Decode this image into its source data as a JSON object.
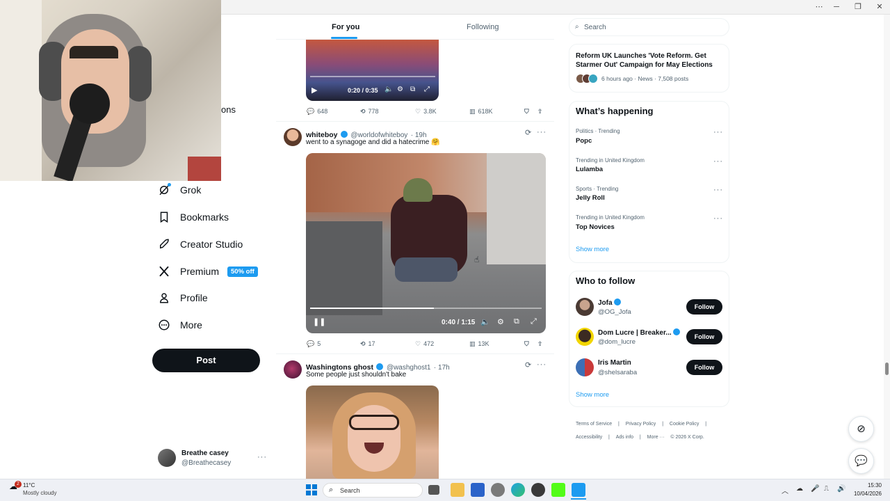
{
  "window": {
    "minimize": "─",
    "restore": "❐",
    "close": "✕",
    "extra": "⋯"
  },
  "webcam": {
    "partial_nav_text": "ons"
  },
  "sidebar": {
    "items": [
      {
        "label": "Grok",
        "icon": "grok-icon"
      },
      {
        "label": "Bookmarks",
        "icon": "bookmark-icon"
      },
      {
        "label": "Creator Studio",
        "icon": "rocket-icon"
      },
      {
        "label": "Premium",
        "icon": "x-logo-icon",
        "badge": "50% off"
      },
      {
        "label": "Profile",
        "icon": "person-icon"
      },
      {
        "label": "More",
        "icon": "more-circle-icon"
      }
    ],
    "post_label": "Post",
    "account": {
      "name": "Breathe casey",
      "handle": "@Breathecasey",
      "more": "···"
    }
  },
  "timeline": {
    "tabs": [
      "For you",
      "Following"
    ],
    "tweet0": {
      "video": {
        "time": "0:20 / 0:35"
      },
      "stats": {
        "replies": "648",
        "reposts": "778",
        "likes": "3.8K",
        "views": "618K"
      }
    },
    "tweet1": {
      "name": "whiteboy",
      "handle": "@worldofwhiteboy",
      "time": "· 19h",
      "text": "went to a synagoge and did a hatecrime 🤗",
      "video": {
        "time": "0:40 / 1:15"
      },
      "stats": {
        "replies": "5",
        "reposts": "17",
        "likes": "472",
        "views": "13K"
      }
    },
    "tweet2": {
      "name": "Washingtons ghost",
      "handle": "@washghost1",
      "time": "· 17h",
      "text": "Some people just shouldn't bake"
    }
  },
  "right": {
    "search_placeholder": "Search",
    "news": {
      "title": "Reform UK Launches 'Vote Reform. Get Starmer Out' Campaign for May Elections",
      "meta": "6 hours ago · News · 7,508 posts"
    },
    "happening": {
      "title": "What’s happening",
      "trends": [
        {
          "category": "Politics · Trending",
          "name": "Popc"
        },
        {
          "category": "Trending in United Kingdom",
          "name": "Lulamba"
        },
        {
          "category": "Sports · Trending",
          "name": "Jelly Roll"
        },
        {
          "category": "Trending in United Kingdom",
          "name": "Top Novices"
        }
      ],
      "show_more": "Show more"
    },
    "who_to_follow": {
      "title": "Who to follow",
      "users": [
        {
          "name": "Jofa",
          "handle": "@OG_Jofa",
          "button": "Follow"
        },
        {
          "name": "Dom Lucre | Breaker...",
          "handle": "@dom_lucre",
          "button": "Follow"
        },
        {
          "name": "Iris Martin",
          "handle": "@shelsaraba",
          "button": "Follow"
        }
      ],
      "show_more": "Show more"
    },
    "footer": {
      "links": [
        "Terms of Service",
        "|",
        "Privacy Policy",
        "|",
        "Cookie Policy",
        "|",
        "Accessibility",
        "|",
        "Ads info",
        "|",
        "More ···",
        "© 2026 X Corp."
      ]
    }
  },
  "taskbar": {
    "weather_temp": "11°C",
    "weather_desc": "Mostly cloudy",
    "weather_badge": "2",
    "search_label": "Search",
    "time": "15:30",
    "date": "10/04/2026"
  },
  "colors": {
    "accent": "#1d9bf0",
    "text": "#0f1419",
    "muted": "#536471"
  }
}
